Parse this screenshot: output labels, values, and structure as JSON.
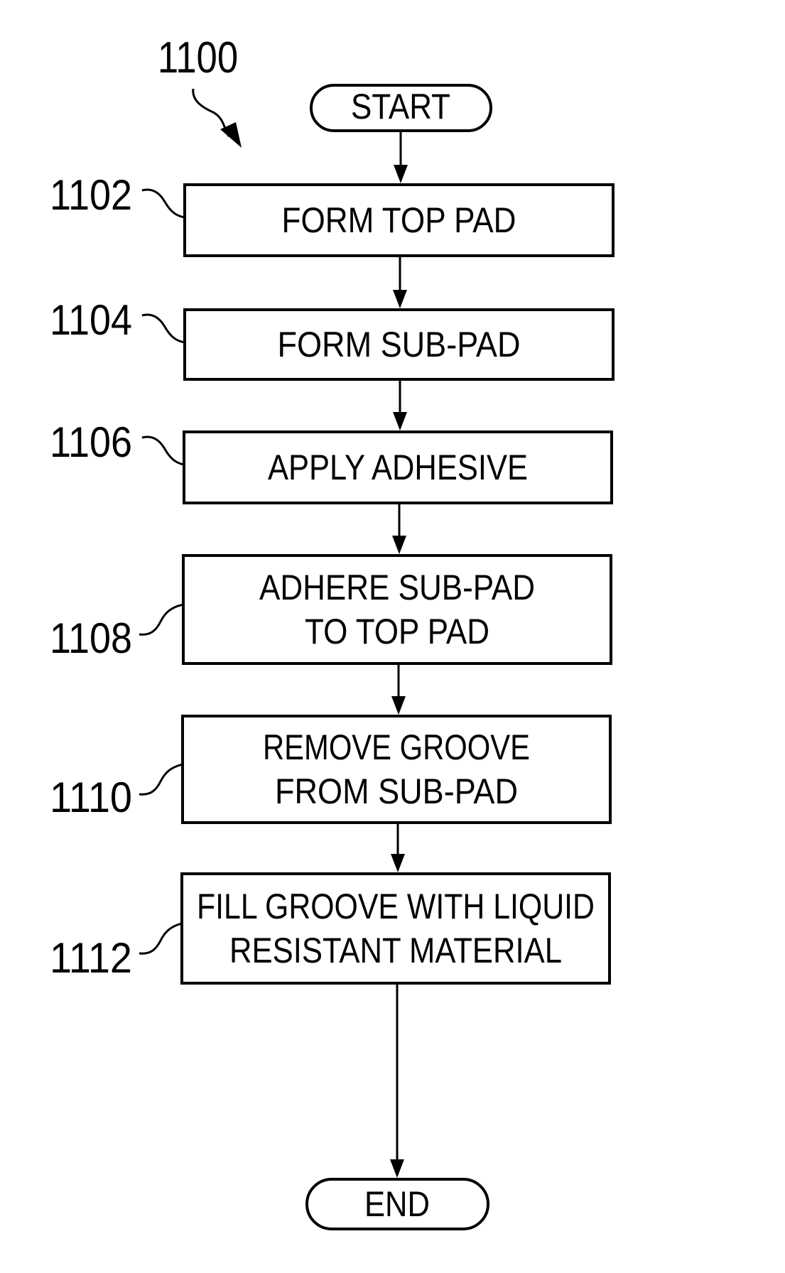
{
  "figure": {
    "id_label": "1100"
  },
  "terminals": {
    "start": "START",
    "end": "END"
  },
  "steps": [
    {
      "ref": "1102",
      "lines": [
        "FORM TOP PAD"
      ]
    },
    {
      "ref": "1104",
      "lines": [
        "FORM SUB-PAD"
      ]
    },
    {
      "ref": "1106",
      "lines": [
        "APPLY ADHESIVE"
      ]
    },
    {
      "ref": "1108",
      "lines": [
        "ADHERE SUB-PAD",
        "TO TOP PAD"
      ]
    },
    {
      "ref": "1110",
      "lines": [
        "REMOVE GROOVE",
        "FROM SUB-PAD"
      ]
    },
    {
      "ref": "1112",
      "lines": [
        "FILL GROOVE WITH LIQUID",
        "RESISTANT MATERIAL"
      ]
    }
  ],
  "colors": {
    "ink": "#000000",
    "paper": "#ffffff"
  }
}
